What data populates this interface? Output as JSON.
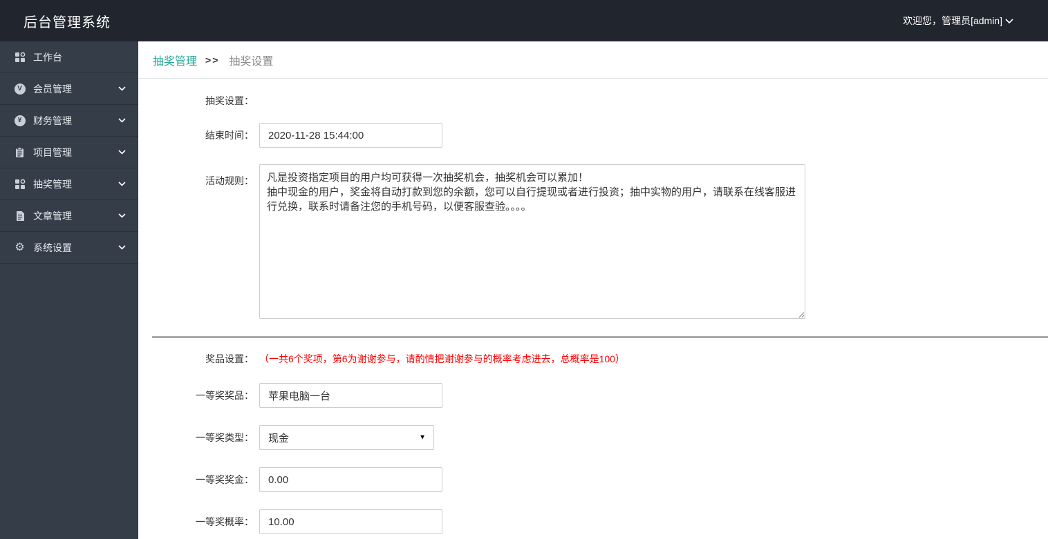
{
  "header": {
    "title": "后台管理系统",
    "welcome": "欢迎您，管理员[admin]"
  },
  "sidebar": {
    "items": [
      {
        "label": "工作台",
        "icon": "dashboard-grid-icon",
        "expandable": false
      },
      {
        "label": "会员管理",
        "icon": "member-circle-icon",
        "glyph": "V",
        "expandable": true
      },
      {
        "label": "财务管理",
        "icon": "finance-circle-icon",
        "glyph": "¥",
        "expandable": true
      },
      {
        "label": "项目管理",
        "icon": "project-clipboard-icon",
        "expandable": true
      },
      {
        "label": "抽奖管理",
        "icon": "lottery-grid-icon",
        "expandable": true
      },
      {
        "label": "文章管理",
        "icon": "article-document-icon",
        "expandable": true
      },
      {
        "label": "系统设置",
        "icon": "settings-gear-icon",
        "glyph": "⚙",
        "expandable": true
      }
    ]
  },
  "breadcrumb": {
    "parent": "抽奖管理",
    "separator": ">>",
    "current": "抽奖设置"
  },
  "form": {
    "section_title": "抽奖设置：",
    "end_time": {
      "label": "结束时间：",
      "value": "2020-11-28 15:44:00"
    },
    "rules": {
      "label": "活动规则：",
      "value": "凡是投资指定项目的用户均可获得一次抽奖机会，抽奖机会可以累加！\n抽中现金的用户，奖金将自动打款到您的余额，您可以自行提现或者进行投资；抽中实物的用户，请联系在线客服进行兑换，联系时请备注您的手机号码，以便客服查验。。。。"
    },
    "prize_section": {
      "label": "奖品设置：",
      "note": "（一共6个奖项，第6为谢谢参与，请酌情把谢谢参与的概率考虑进去，总概率是100）"
    },
    "first_prize_item": {
      "label": "一等奖奖品：",
      "value": "苹果电脑一台"
    },
    "first_prize_type": {
      "label": "一等奖类型：",
      "value": "现金"
    },
    "first_prize_amount": {
      "label": "一等奖奖金：",
      "value": "0.00"
    },
    "first_prize_probability": {
      "label": "一等奖概率：",
      "value": "10.00"
    }
  },
  "colors": {
    "header_bg": "#21252e",
    "sidebar_bg": "#353d49",
    "accent_teal": "#22a695",
    "note_red": "#ff0000"
  }
}
